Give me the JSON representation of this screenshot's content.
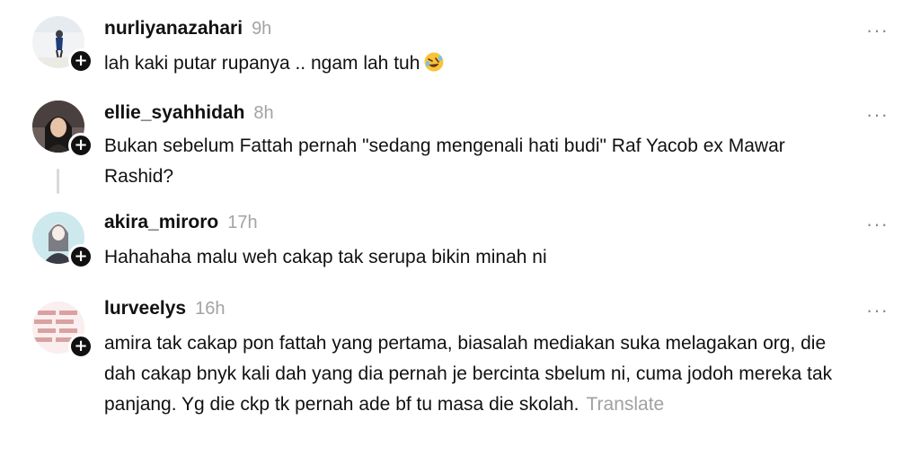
{
  "comments": [
    {
      "username": "nurliyanazahari",
      "time": "9h",
      "text": "lah kaki putar rupanya .. ngam lah tuh",
      "emoji": "rolling-on-floor-laughing-emoji"
    },
    {
      "username": "ellie_syahhidah",
      "time": "8h",
      "text": "Bukan sebelum Fattah pernah \"sedang mengenali hati budi\" Raf Yacob ex Mawar Rashid?"
    },
    {
      "username": "akira_miroro",
      "time": "17h",
      "text": "Hahahaha malu weh cakap tak serupa bikin minah ni"
    },
    {
      "username": "lurveelys",
      "time": "16h",
      "text": "amira tak cakap pon fattah yang pertama, biasalah mediakan suka melagakan org, die dah cakap bnyk kali dah yang dia pernah je bercinta sbelum ni, cuma jodoh mereka tak panjang. Yg die ckp tk pernah ade bf tu masa die skolah.",
      "translate_label": "Translate"
    }
  ],
  "icons": {
    "more": "more-horizontal-icon",
    "follow": "plus-icon"
  },
  "colors": {
    "muted": "#a3a3a3",
    "text": "#111111",
    "thread_line": "#d9d9d9"
  }
}
